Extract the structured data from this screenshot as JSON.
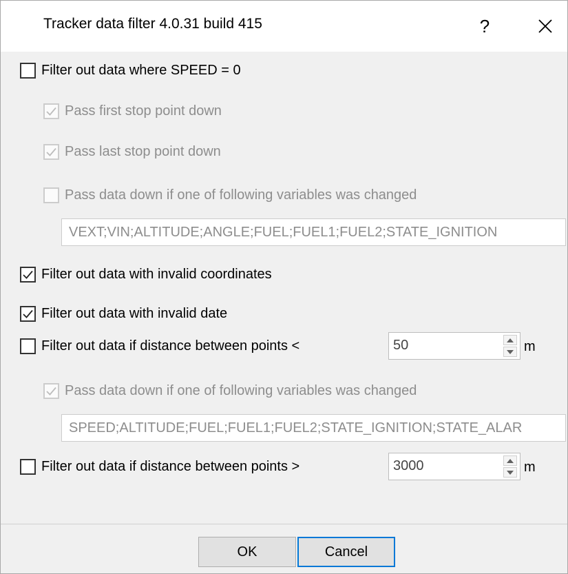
{
  "window": {
    "title": "Tracker data filter 4.0.31 build 415",
    "help_label": "?"
  },
  "options": {
    "speed_zero": {
      "label": "Filter out data where SPEED = 0",
      "checked": false,
      "enabled": true
    },
    "pass_first_stop": {
      "label": "Pass first stop point down",
      "checked": true,
      "enabled": false
    },
    "pass_last_stop": {
      "label": "Pass last stop point down",
      "checked": true,
      "enabled": false
    },
    "pass_changed_speed": {
      "label": "Pass data down if one of following variables was changed",
      "checked": false,
      "enabled": false
    },
    "speed_vars_value": "VEXT;VIN;ALTITUDE;ANGLE;FUEL;FUEL1;FUEL2;STATE_IGNITION",
    "invalid_coords": {
      "label": "Filter out data with invalid coordinates",
      "checked": true,
      "enabled": true
    },
    "invalid_date": {
      "label": "Filter out data with invalid date",
      "checked": true,
      "enabled": true
    },
    "distance_less": {
      "label": "Filter out data if distance between points <",
      "checked": false,
      "enabled": true,
      "value": "50",
      "unit": "m"
    },
    "pass_changed_distance": {
      "label": "Pass data down if one of following variables was changed",
      "checked": true,
      "enabled": false
    },
    "distance_vars_value": "SPEED;ALTITUDE;FUEL;FUEL1;FUEL2;STATE_IGNITION;STATE_ALAR",
    "distance_greater": {
      "label": "Filter out data if distance between points >",
      "checked": false,
      "enabled": true,
      "value": "3000",
      "unit": "m"
    }
  },
  "buttons": {
    "ok_label": "OK",
    "cancel_label": "Cancel"
  },
  "colors": {
    "dialog_bg": "#f0f0f0",
    "disabled_text": "#8d8d8d",
    "focus_border": "#0078d7"
  }
}
